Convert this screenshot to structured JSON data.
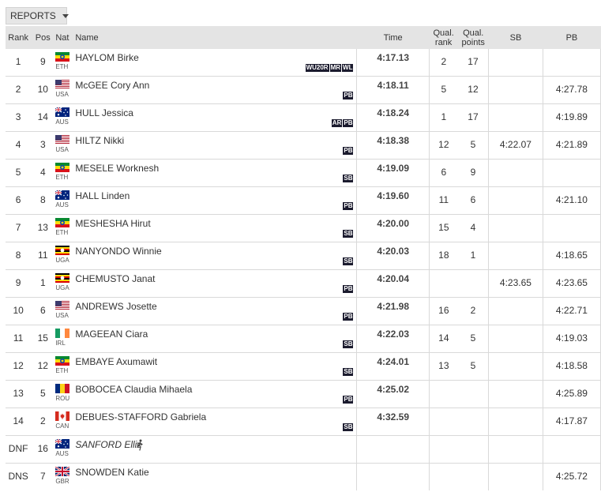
{
  "reports_button": {
    "label": "REPORTS",
    "icon": "caret-down-icon"
  },
  "table": {
    "headers": {
      "rank": "Rank",
      "pos": "Pos",
      "nat": "Nat",
      "name": "Name",
      "time": "Time",
      "qual_rank": "Qual. rank",
      "qual_points": "Qual. points",
      "sb": "SB",
      "pb": "PB"
    },
    "rows": [
      {
        "rank": "1",
        "pos": "9",
        "nat": "ETH",
        "name": "HAYLOM Birke",
        "badges": [
          "WU20R",
          "MR",
          "WL"
        ],
        "time": "4:17.13",
        "qual_rank": "2",
        "qual_points": "17",
        "sb": "",
        "pb": ""
      },
      {
        "rank": "2",
        "pos": "10",
        "nat": "USA",
        "name": "McGEE Cory Ann",
        "badges": [
          "PB"
        ],
        "time": "4:18.11",
        "qual_rank": "5",
        "qual_points": "12",
        "sb": "",
        "pb": "4:27.78"
      },
      {
        "rank": "3",
        "pos": "14",
        "nat": "AUS",
        "name": "HULL Jessica",
        "badges": [
          "AR",
          "PB"
        ],
        "time": "4:18.24",
        "qual_rank": "1",
        "qual_points": "17",
        "sb": "",
        "pb": "4:19.89"
      },
      {
        "rank": "4",
        "pos": "3",
        "nat": "USA",
        "name": "HILTZ Nikki",
        "badges": [
          "PB"
        ],
        "time": "4:18.38",
        "qual_rank": "12",
        "qual_points": "5",
        "sb": "4:22.07",
        "pb": "4:21.89"
      },
      {
        "rank": "5",
        "pos": "4",
        "nat": "ETH",
        "name": "MESELE Worknesh",
        "badges": [
          "SB"
        ],
        "time": "4:19.09",
        "qual_rank": "6",
        "qual_points": "9",
        "sb": "",
        "pb": ""
      },
      {
        "rank": "6",
        "pos": "8",
        "nat": "AUS",
        "name": "HALL Linden",
        "badges": [
          "PB"
        ],
        "time": "4:19.60",
        "qual_rank": "11",
        "qual_points": "6",
        "sb": "",
        "pb": "4:21.10"
      },
      {
        "rank": "7",
        "pos": "13",
        "nat": "ETH",
        "name": "MESHESHA Hirut",
        "badges": [
          "SB"
        ],
        "time": "4:20.00",
        "qual_rank": "15",
        "qual_points": "4",
        "sb": "",
        "pb": ""
      },
      {
        "rank": "8",
        "pos": "11",
        "nat": "UGA",
        "name": "NANYONDO Winnie",
        "badges": [
          "SB"
        ],
        "time": "4:20.03",
        "qual_rank": "18",
        "qual_points": "1",
        "sb": "",
        "pb": "4:18.65"
      },
      {
        "rank": "9",
        "pos": "1",
        "nat": "UGA",
        "name": "CHEMUSTO Janat",
        "badges": [
          "PB"
        ],
        "time": "4:20.04",
        "qual_rank": "",
        "qual_points": "",
        "sb": "4:23.65",
        "pb": "4:23.65"
      },
      {
        "rank": "10",
        "pos": "6",
        "nat": "USA",
        "name": "ANDREWS Josette",
        "badges": [
          "PB"
        ],
        "time": "4:21.98",
        "qual_rank": "16",
        "qual_points": "2",
        "sb": "",
        "pb": "4:22.71"
      },
      {
        "rank": "11",
        "pos": "15",
        "nat": "IRL",
        "name": "MAGEEAN Ciara",
        "badges": [
          "SB"
        ],
        "time": "4:22.03",
        "qual_rank": "14",
        "qual_points": "5",
        "sb": "",
        "pb": "4:19.03"
      },
      {
        "rank": "12",
        "pos": "12",
        "nat": "ETH",
        "name": "EMBAYE Axumawit",
        "badges": [
          "SB"
        ],
        "time": "4:24.01",
        "qual_rank": "13",
        "qual_points": "5",
        "sb": "",
        "pb": "4:18.58"
      },
      {
        "rank": "13",
        "pos": "5",
        "nat": "ROU",
        "name": "BOBOCEA Claudia Mihaela",
        "badges": [
          "PB"
        ],
        "time": "4:25.02",
        "qual_rank": "",
        "qual_points": "",
        "sb": "",
        "pb": "4:25.89"
      },
      {
        "rank": "14",
        "pos": "2",
        "nat": "CAN",
        "name": "DEBUES-STAFFORD Gabriela",
        "badges": [
          "SB"
        ],
        "time": "4:32.59",
        "qual_rank": "",
        "qual_points": "",
        "sb": "",
        "pb": "4:17.87"
      },
      {
        "rank": "DNF",
        "pos": "16",
        "nat": "AUS",
        "name": "SANFORD Ellie",
        "badges": [],
        "status_icon": "runner-fallen-icon",
        "time": "",
        "qual_rank": "",
        "qual_points": "",
        "sb": "",
        "pb": ""
      },
      {
        "rank": "DNS",
        "pos": "7",
        "nat": "GBR",
        "name": "SNOWDEN Katie",
        "badges": [],
        "time": "",
        "qual_rank": "",
        "qual_points": "",
        "sb": "",
        "pb": "4:25.72"
      }
    ]
  },
  "colors": {
    "header_bg": "#e4e4e4",
    "badge_bg": "#1b1b2e",
    "row_border": "#d9d9d9"
  }
}
